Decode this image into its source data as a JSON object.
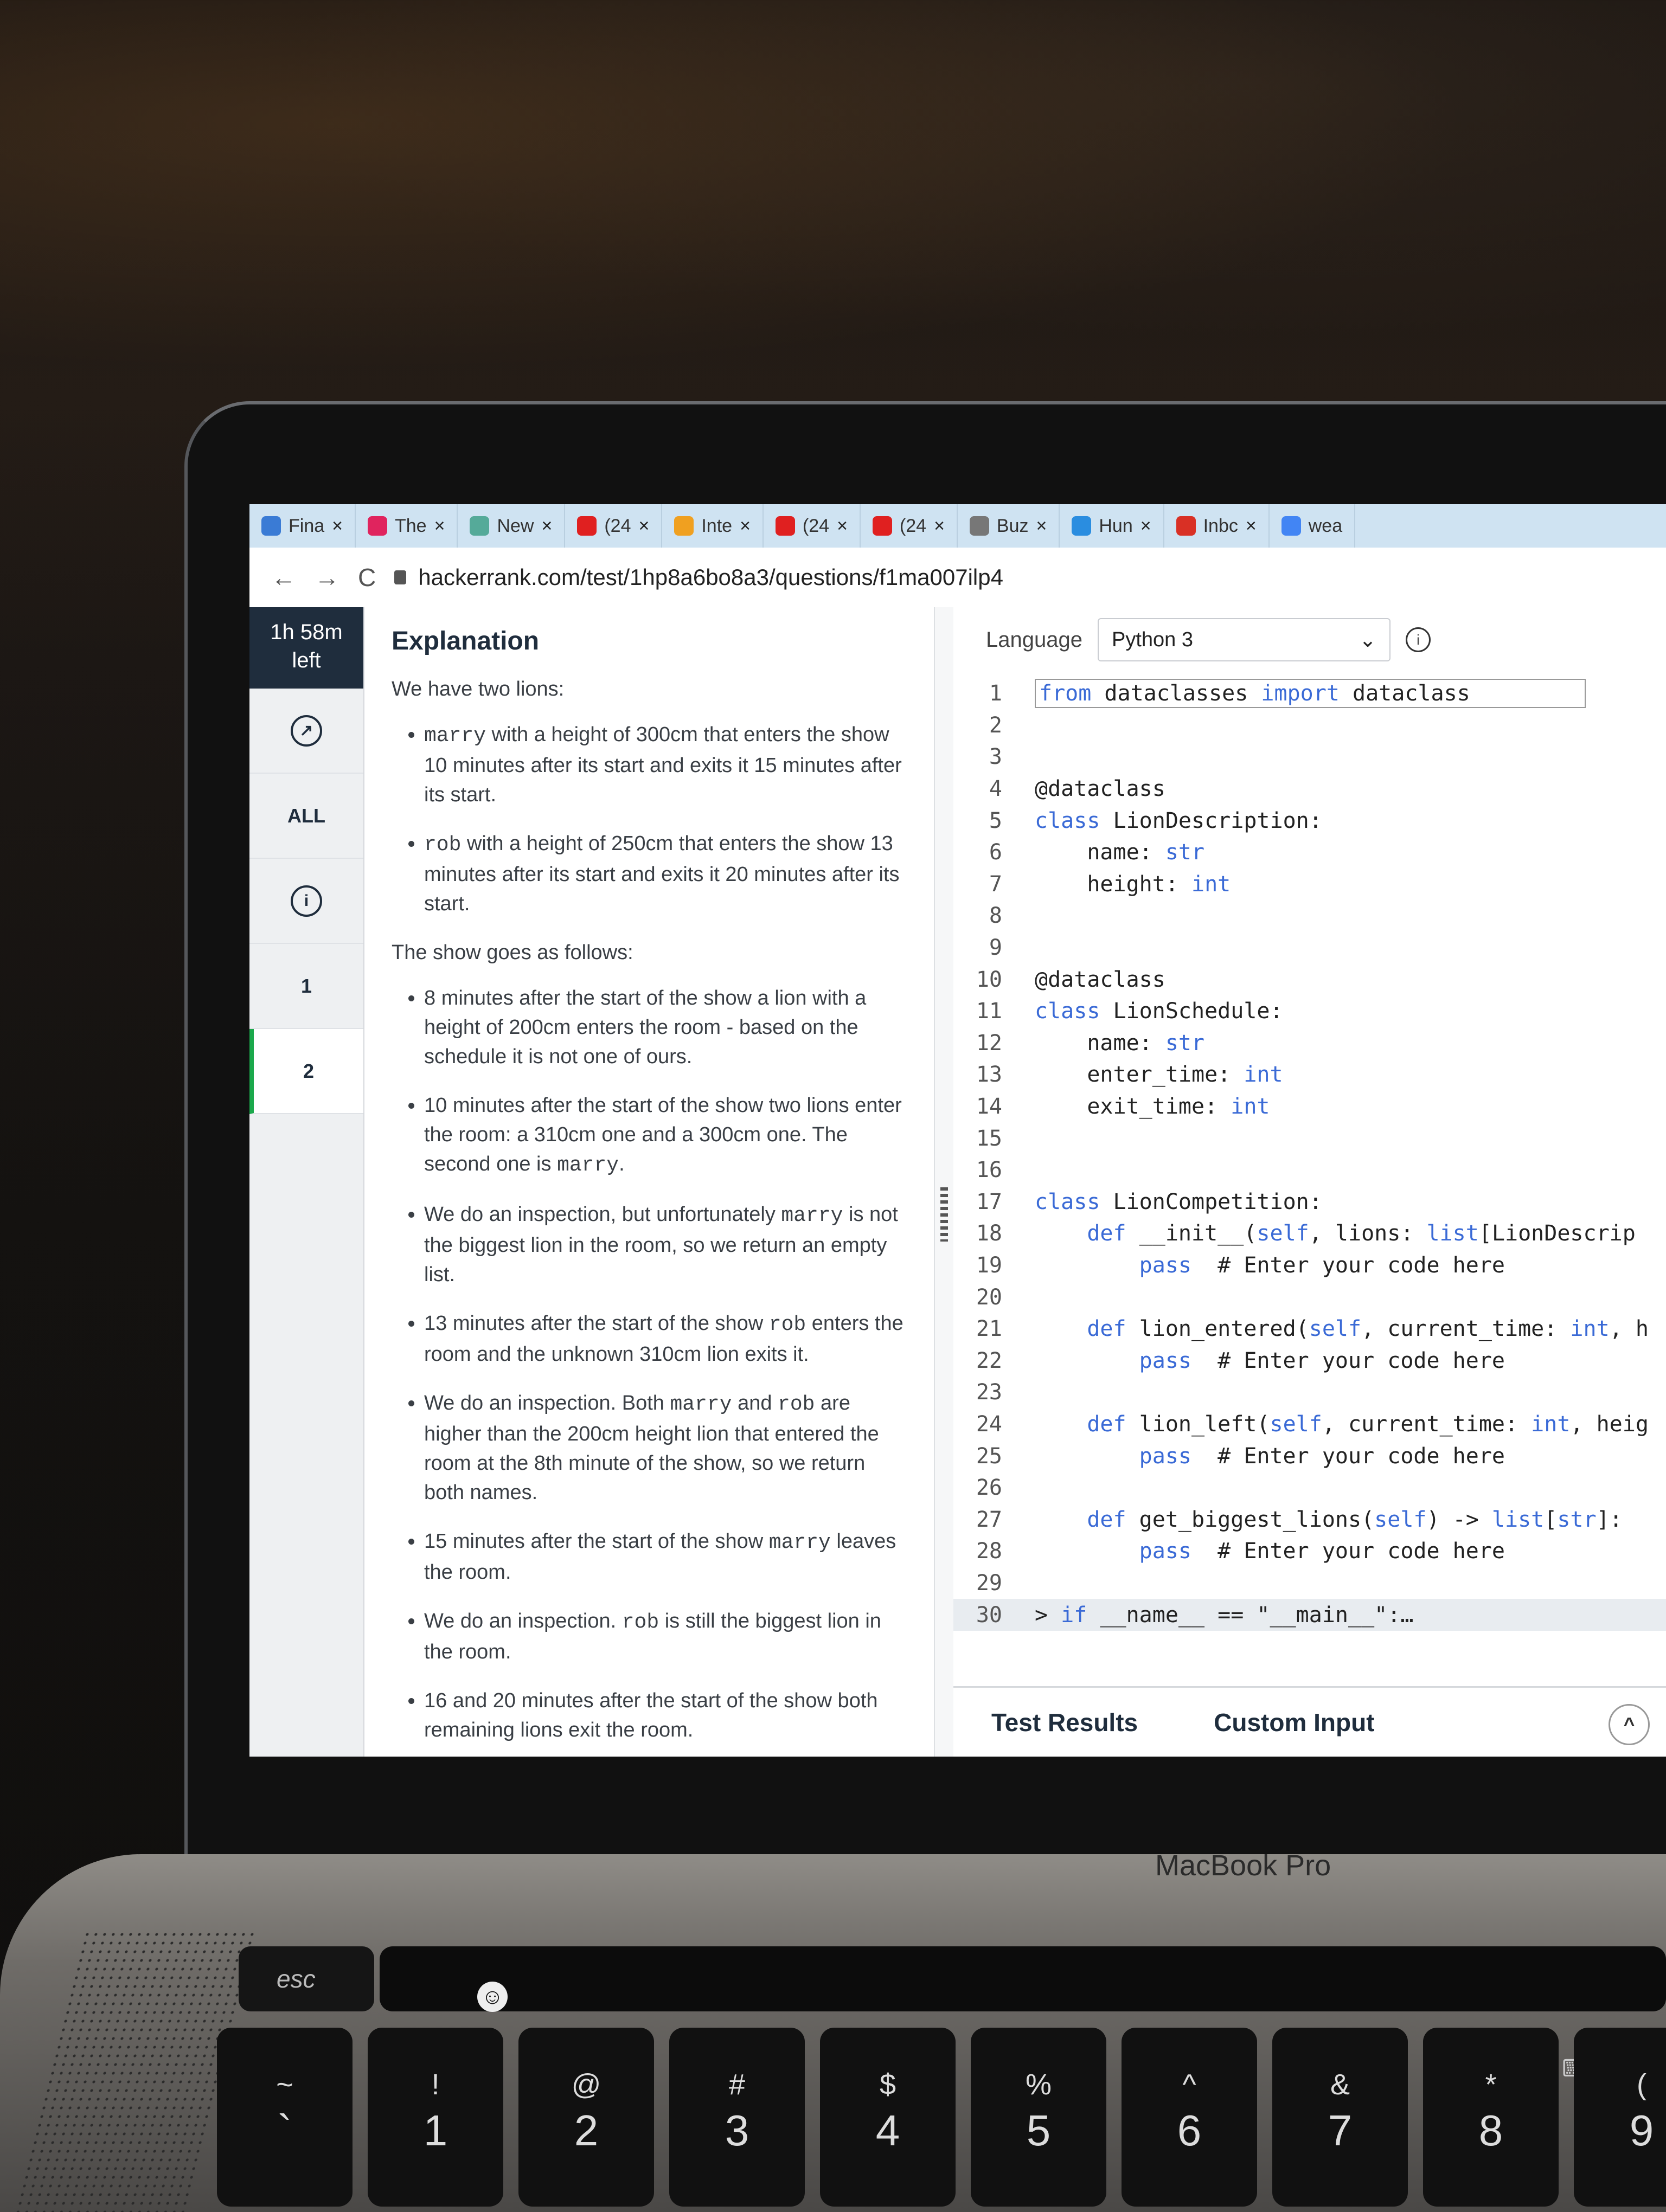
{
  "tabs": [
    {
      "label": "Fina",
      "icon": "board-icon",
      "color": "#3a7bd5"
    },
    {
      "label": "The",
      "icon": "youtube-icon",
      "color": "#e0245e"
    },
    {
      "label": "New",
      "icon": "chatgpt-icon",
      "color": "#5a9"
    },
    {
      "label": "(24",
      "icon": "youtube-icon",
      "color": "#e02020"
    },
    {
      "label": "Inte",
      "icon": "ai-icon",
      "color": "#f0a020"
    },
    {
      "label": "(24",
      "icon": "youtube-icon",
      "color": "#e02020"
    },
    {
      "label": "(24",
      "icon": "youtube-icon",
      "color": "#e02020"
    },
    {
      "label": "Buz",
      "icon": "buzz-icon",
      "color": "#777"
    },
    {
      "label": "Hun",
      "icon": "hunter-icon",
      "color": "#2a8de0"
    },
    {
      "label": "Inbc",
      "icon": "gmail-icon",
      "color": "#d93025"
    },
    {
      "label": "wea",
      "icon": "google-icon",
      "color": "#4285f4"
    }
  ],
  "nav": {
    "back": "←",
    "forward": "→",
    "reload": "C"
  },
  "url": "hackerrank.com/test/1hp8a6bo8a3/questions/f1ma007ilp4",
  "sidebar": {
    "timer_line1": "1h 58m",
    "timer_line2": "left",
    "all": "ALL",
    "info": "i",
    "q1": "1",
    "q2": "2"
  },
  "problem": {
    "title": "Explanation",
    "intro": "We have two lions:",
    "lion1_name": "marry",
    "lion1_text": " with a height of 300cm that enters the show 10 minutes after its start and exits it 15 minutes after its start.",
    "lion2_name": "rob",
    "lion2_text": " with a height of 250cm that enters the show 13 minutes after its start and exits it 20 minutes after its start.",
    "show_heading": "The show goes as follows:",
    "s1": "8 minutes after the start of the show a lion with a height of 200cm enters the room - based on the schedule it is not one of ours.",
    "s2a": "10 minutes after the start of the show two lions enter the room: a 310cm one and a 300cm one. The second one is ",
    "s2b": "marry",
    "s2c": ".",
    "s3a": "We do an inspection, but unfortunately ",
    "s3b": "marry",
    "s3c": " is not the biggest lion in the room, so we return an empty list.",
    "s4a": "13 minutes after the start of the show ",
    "s4b": "rob",
    "s4c": " enters the room and the unknown 310cm lion exits it.",
    "s5a": "We do an inspection. Both ",
    "s5b": "marry",
    "s5c": " and ",
    "s5d": "rob",
    "s5e": " are higher than the 200cm height lion that entered the room at the 8th minute of the show, so we return both names.",
    "s6a": "15 minutes after the start of the show ",
    "s6b": "marry",
    "s6c": " leaves the room.",
    "s7a": "We do an inspection. ",
    "s7b": "rob",
    "s7c": " is still the biggest lion in the room.",
    "s8": "16 and 20 minutes after the start of the show both remaining lions exit the room."
  },
  "editor": {
    "language_label": "Language",
    "language_value": "Python 3",
    "lines": [
      {
        "n": "1",
        "code": "from dataclasses import dataclass"
      },
      {
        "n": "2",
        "code": ""
      },
      {
        "n": "3",
        "code": ""
      },
      {
        "n": "4",
        "code": "@dataclass"
      },
      {
        "n": "5",
        "code": "class LionDescription:"
      },
      {
        "n": "6",
        "code": "    name: str"
      },
      {
        "n": "7",
        "code": "    height: int"
      },
      {
        "n": "8",
        "code": ""
      },
      {
        "n": "9",
        "code": ""
      },
      {
        "n": "10",
        "code": "@dataclass"
      },
      {
        "n": "11",
        "code": "class LionSchedule:"
      },
      {
        "n": "12",
        "code": "    name: str"
      },
      {
        "n": "13",
        "code": "    enter_time: int"
      },
      {
        "n": "14",
        "code": "    exit_time: int"
      },
      {
        "n": "15",
        "code": ""
      },
      {
        "n": "16",
        "code": ""
      },
      {
        "n": "17",
        "code": "class LionCompetition:"
      },
      {
        "n": "18",
        "code": "    def __init__(self, lions: list[LionDescrip"
      },
      {
        "n": "19",
        "code": "        pass  # Enter your code here"
      },
      {
        "n": "20",
        "code": ""
      },
      {
        "n": "21",
        "code": "    def lion_entered(self, current_time: int, h"
      },
      {
        "n": "22",
        "code": "        pass  # Enter your code here"
      },
      {
        "n": "23",
        "code": ""
      },
      {
        "n": "24",
        "code": "    def lion_left(self, current_time: int, heig"
      },
      {
        "n": "25",
        "code": "        pass  # Enter your code here"
      },
      {
        "n": "26",
        "code": ""
      },
      {
        "n": "27",
        "code": "    def get_biggest_lions(self) -> list[str]:"
      },
      {
        "n": "28",
        "code": "        pass  # Enter your code here"
      },
      {
        "n": "29",
        "code": ""
      },
      {
        "n": "30",
        "code": "> if __name__ == \"__main__\":…"
      }
    ],
    "tab_results": "Test Results",
    "tab_custom": "Custom Input"
  },
  "laptop": {
    "brand": "MacBook Pro",
    "esc": "esc",
    "keys": [
      {
        "s": "~",
        "n": "`"
      },
      {
        "s": "!",
        "n": "1"
      },
      {
        "s": "@",
        "n": "2"
      },
      {
        "s": "#",
        "n": "3"
      },
      {
        "s": "$",
        "n": "4"
      },
      {
        "s": "%",
        "n": "5"
      },
      {
        "s": "^",
        "n": "6"
      },
      {
        "s": "&",
        "n": "7"
      },
      {
        "s": "*",
        "n": "8"
      },
      {
        "s": "(",
        "n": "9"
      }
    ]
  }
}
